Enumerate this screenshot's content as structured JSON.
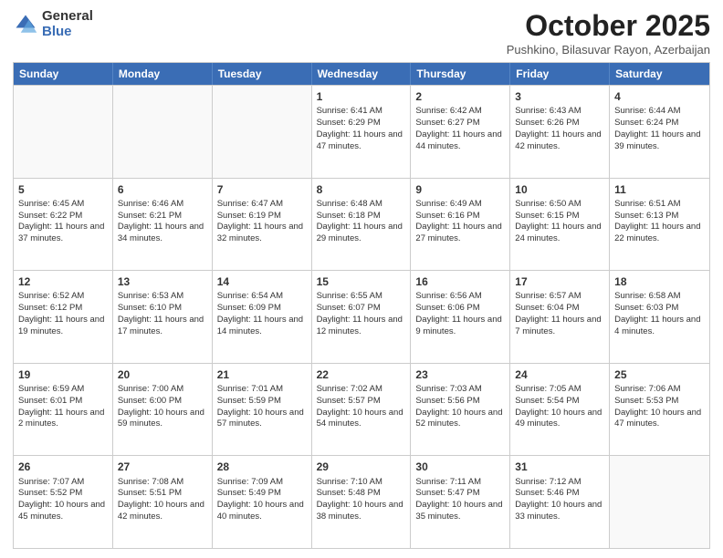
{
  "logo": {
    "general": "General",
    "blue": "Blue"
  },
  "header": {
    "month": "October 2025",
    "location": "Pushkino, Bilasuvar Rayon, Azerbaijan"
  },
  "days": [
    "Sunday",
    "Monday",
    "Tuesday",
    "Wednesday",
    "Thursday",
    "Friday",
    "Saturday"
  ],
  "weeks": [
    [
      {
        "day": "",
        "info": ""
      },
      {
        "day": "",
        "info": ""
      },
      {
        "day": "",
        "info": ""
      },
      {
        "day": "1",
        "info": "Sunrise: 6:41 AM\nSunset: 6:29 PM\nDaylight: 11 hours and 47 minutes."
      },
      {
        "day": "2",
        "info": "Sunrise: 6:42 AM\nSunset: 6:27 PM\nDaylight: 11 hours and 44 minutes."
      },
      {
        "day": "3",
        "info": "Sunrise: 6:43 AM\nSunset: 6:26 PM\nDaylight: 11 hours and 42 minutes."
      },
      {
        "day": "4",
        "info": "Sunrise: 6:44 AM\nSunset: 6:24 PM\nDaylight: 11 hours and 39 minutes."
      }
    ],
    [
      {
        "day": "5",
        "info": "Sunrise: 6:45 AM\nSunset: 6:22 PM\nDaylight: 11 hours and 37 minutes."
      },
      {
        "day": "6",
        "info": "Sunrise: 6:46 AM\nSunset: 6:21 PM\nDaylight: 11 hours and 34 minutes."
      },
      {
        "day": "7",
        "info": "Sunrise: 6:47 AM\nSunset: 6:19 PM\nDaylight: 11 hours and 32 minutes."
      },
      {
        "day": "8",
        "info": "Sunrise: 6:48 AM\nSunset: 6:18 PM\nDaylight: 11 hours and 29 minutes."
      },
      {
        "day": "9",
        "info": "Sunrise: 6:49 AM\nSunset: 6:16 PM\nDaylight: 11 hours and 27 minutes."
      },
      {
        "day": "10",
        "info": "Sunrise: 6:50 AM\nSunset: 6:15 PM\nDaylight: 11 hours and 24 minutes."
      },
      {
        "day": "11",
        "info": "Sunrise: 6:51 AM\nSunset: 6:13 PM\nDaylight: 11 hours and 22 minutes."
      }
    ],
    [
      {
        "day": "12",
        "info": "Sunrise: 6:52 AM\nSunset: 6:12 PM\nDaylight: 11 hours and 19 minutes."
      },
      {
        "day": "13",
        "info": "Sunrise: 6:53 AM\nSunset: 6:10 PM\nDaylight: 11 hours and 17 minutes."
      },
      {
        "day": "14",
        "info": "Sunrise: 6:54 AM\nSunset: 6:09 PM\nDaylight: 11 hours and 14 minutes."
      },
      {
        "day": "15",
        "info": "Sunrise: 6:55 AM\nSunset: 6:07 PM\nDaylight: 11 hours and 12 minutes."
      },
      {
        "day": "16",
        "info": "Sunrise: 6:56 AM\nSunset: 6:06 PM\nDaylight: 11 hours and 9 minutes."
      },
      {
        "day": "17",
        "info": "Sunrise: 6:57 AM\nSunset: 6:04 PM\nDaylight: 11 hours and 7 minutes."
      },
      {
        "day": "18",
        "info": "Sunrise: 6:58 AM\nSunset: 6:03 PM\nDaylight: 11 hours and 4 minutes."
      }
    ],
    [
      {
        "day": "19",
        "info": "Sunrise: 6:59 AM\nSunset: 6:01 PM\nDaylight: 11 hours and 2 minutes."
      },
      {
        "day": "20",
        "info": "Sunrise: 7:00 AM\nSunset: 6:00 PM\nDaylight: 10 hours and 59 minutes."
      },
      {
        "day": "21",
        "info": "Sunrise: 7:01 AM\nSunset: 5:59 PM\nDaylight: 10 hours and 57 minutes."
      },
      {
        "day": "22",
        "info": "Sunrise: 7:02 AM\nSunset: 5:57 PM\nDaylight: 10 hours and 54 minutes."
      },
      {
        "day": "23",
        "info": "Sunrise: 7:03 AM\nSunset: 5:56 PM\nDaylight: 10 hours and 52 minutes."
      },
      {
        "day": "24",
        "info": "Sunrise: 7:05 AM\nSunset: 5:54 PM\nDaylight: 10 hours and 49 minutes."
      },
      {
        "day": "25",
        "info": "Sunrise: 7:06 AM\nSunset: 5:53 PM\nDaylight: 10 hours and 47 minutes."
      }
    ],
    [
      {
        "day": "26",
        "info": "Sunrise: 7:07 AM\nSunset: 5:52 PM\nDaylight: 10 hours and 45 minutes."
      },
      {
        "day": "27",
        "info": "Sunrise: 7:08 AM\nSunset: 5:51 PM\nDaylight: 10 hours and 42 minutes."
      },
      {
        "day": "28",
        "info": "Sunrise: 7:09 AM\nSunset: 5:49 PM\nDaylight: 10 hours and 40 minutes."
      },
      {
        "day": "29",
        "info": "Sunrise: 7:10 AM\nSunset: 5:48 PM\nDaylight: 10 hours and 38 minutes."
      },
      {
        "day": "30",
        "info": "Sunrise: 7:11 AM\nSunset: 5:47 PM\nDaylight: 10 hours and 35 minutes."
      },
      {
        "day": "31",
        "info": "Sunrise: 7:12 AM\nSunset: 5:46 PM\nDaylight: 10 hours and 33 minutes."
      },
      {
        "day": "",
        "info": ""
      }
    ]
  ]
}
